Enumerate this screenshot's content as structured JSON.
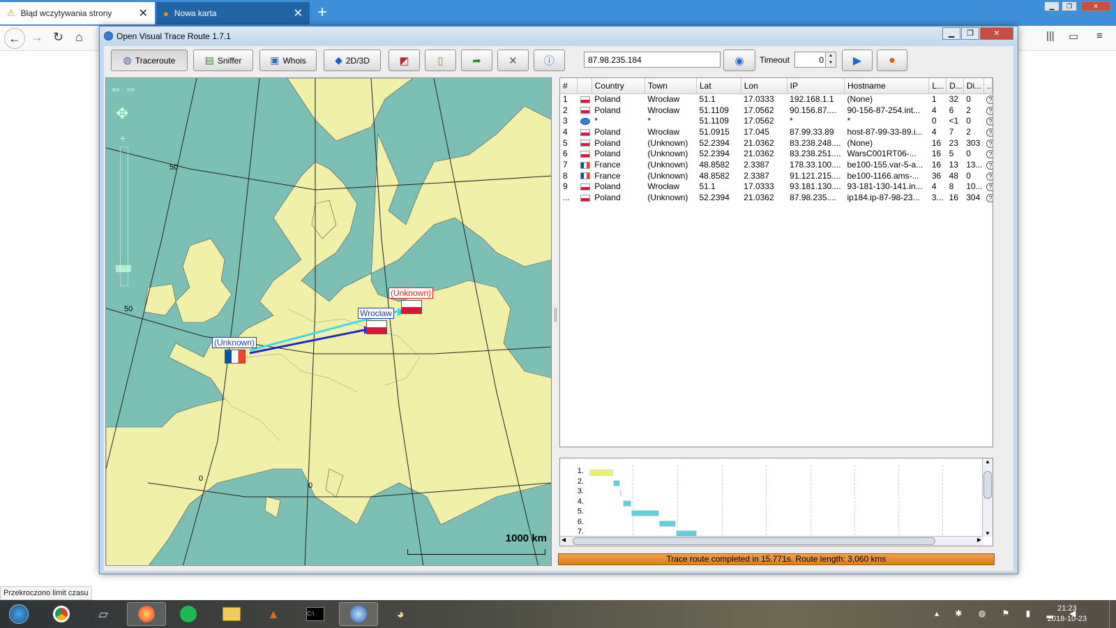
{
  "browser": {
    "tabs": [
      {
        "title": "Błąd wczytywania strony",
        "icon": "warning-icon"
      },
      {
        "title": "Nowa karta",
        "icon": "firefox-icon"
      }
    ],
    "status_hint": "Przekroczono limit czasu"
  },
  "app": {
    "title": "Open Visual Trace Route 1.7.1",
    "toolbar": {
      "traceroute": "Traceroute",
      "sniffer": "Sniffer",
      "whois": "Whois",
      "view_mode": "2D/3D",
      "ip_value": "87.98.235.184",
      "timeout_label": "Timeout",
      "timeout_value": "0"
    },
    "map": {
      "grid_labels": [
        "50",
        "50",
        "0",
        "0"
      ],
      "scale_label": "1000 km",
      "points": [
        {
          "label": "(Unknown)",
          "flag": "pl",
          "color": "#e02020"
        },
        {
          "label": "Wrocław",
          "flag": "pl",
          "color": "#1b3fa8"
        },
        {
          "label": "(Unknown)",
          "flag": "fr",
          "color": "#1b3fa8"
        }
      ]
    },
    "table": {
      "columns": [
        "#",
        "",
        "Country",
        "Town",
        "Lat",
        "Lon",
        "IP",
        "Hostname",
        "L...",
        "D...",
        "Di...",
        "..."
      ],
      "rows": [
        {
          "num": "1",
          "flag": "pl",
          "country": "Poland",
          "town": "Wrocław",
          "lat": "51.1",
          "lon": "17.0333",
          "ip": "192.168.1.1",
          "host": "(None)",
          "l": "1",
          "d": "32",
          "di": "0"
        },
        {
          "num": "2",
          "flag": "pl",
          "country": "Poland",
          "town": "Wrocław",
          "lat": "51.1109",
          "lon": "17.0562",
          "ip": "90.156.87....",
          "host": "90-156-87-254.int...",
          "l": "4",
          "d": "6",
          "di": "2"
        },
        {
          "num": "3",
          "flag": "unk",
          "country": "*",
          "town": "*",
          "lat": "51.1109",
          "lon": "17.0562",
          "ip": "*",
          "host": "*",
          "l": "0",
          "d": "<1",
          "di": "0"
        },
        {
          "num": "4",
          "flag": "pl",
          "country": "Poland",
          "town": "Wrocław",
          "lat": "51.0915",
          "lon": "17.045",
          "ip": "87.99.33.89",
          "host": "host-87-99-33-89.i...",
          "l": "4",
          "d": "7",
          "di": "2"
        },
        {
          "num": "5",
          "flag": "pl",
          "country": "Poland",
          "town": "(Unknown)",
          "lat": "52.2394",
          "lon": "21.0362",
          "ip": "83.238.248....",
          "host": "(None)",
          "l": "16",
          "d": "23",
          "di": "303"
        },
        {
          "num": "6",
          "flag": "pl",
          "country": "Poland",
          "town": "(Unknown)",
          "lat": "52.2394",
          "lon": "21.0362",
          "ip": "83.238.251....",
          "host": "WarsC001RT06-...",
          "l": "16",
          "d": "5",
          "di": "0"
        },
        {
          "num": "7",
          "flag": "fr",
          "country": "France",
          "town": "(Unknown)",
          "lat": "48.8582",
          "lon": "2.3387",
          "ip": "178.33.100....",
          "host": "be100-155.var-5-a...",
          "l": "16",
          "d": "13",
          "di": "13..."
        },
        {
          "num": "8",
          "flag": "fr",
          "country": "France",
          "town": "(Unknown)",
          "lat": "48.8582",
          "lon": "2.3387",
          "ip": "91.121.215....",
          "host": "be100-1166.ams-...",
          "l": "36",
          "d": "48",
          "di": "0"
        },
        {
          "num": "9",
          "flag": "pl",
          "country": "Poland",
          "town": "Wrocław",
          "lat": "51.1",
          "lon": "17.0333",
          "ip": "93.181.130....",
          "host": "93-181-130-141.in...",
          "l": "4",
          "d": "8",
          "di": "10..."
        },
        {
          "num": "...",
          "flag": "pl",
          "country": "Poland",
          "town": "(Unknown)",
          "lat": "52.2394",
          "lon": "21.0362",
          "ip": "87.98.235....",
          "host": "ip184.ip-87-98-23...",
          "l": "3...",
          "d": "16",
          "di": "304"
        }
      ]
    },
    "gantt": {
      "labels": [
        "1.",
        "2.",
        "3.",
        "4.",
        "5.",
        "6.",
        "7."
      ]
    },
    "status": "Trace route completed in 15.771s. Route length: 3,060 kms"
  },
  "taskbar": {
    "clock_time": "21:23",
    "clock_date": "2018-10-23"
  },
  "colors": {
    "sea": "#7bbfb5",
    "land": "#f0f0a8",
    "status_orange": "#e68a2e",
    "tab_bar": "#3e8fd9"
  }
}
